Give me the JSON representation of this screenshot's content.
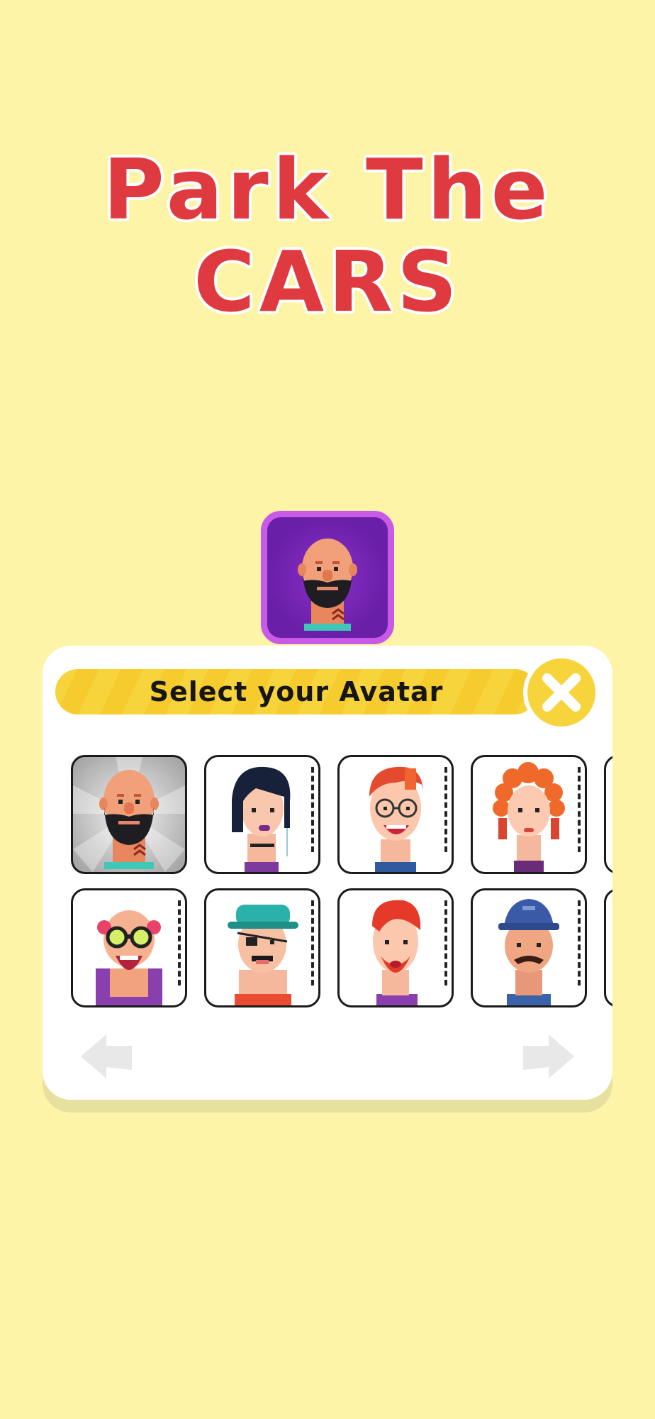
{
  "title": {
    "line1": "Park The",
    "line2": "CARS"
  },
  "selected_avatar": {
    "name": "bald-bearded-man"
  },
  "panel": {
    "header": "Select your Avatar",
    "close_icon": "close-icon"
  },
  "avatars": [
    {
      "name": "bald-bearded-man",
      "selected": true
    },
    {
      "name": "black-hair-woman",
      "selected": false
    },
    {
      "name": "glasses-redhead-man",
      "selected": false
    },
    {
      "name": "curly-redhead-woman",
      "selected": false
    },
    {
      "name": "goggles-old-man",
      "selected": false
    },
    {
      "name": "hat-eyepatch-man",
      "selected": false
    },
    {
      "name": "red-beard-man",
      "selected": false
    },
    {
      "name": "cap-mustache-man",
      "selected": false
    }
  ],
  "nav": {
    "prev_icon": "arrow-left-icon",
    "next_icon": "arrow-right-icon"
  },
  "colors": {
    "background": "#fef4a8",
    "title": "#de3a3f",
    "header": "#f8d43c",
    "selected_frame": "#c95ae8"
  }
}
